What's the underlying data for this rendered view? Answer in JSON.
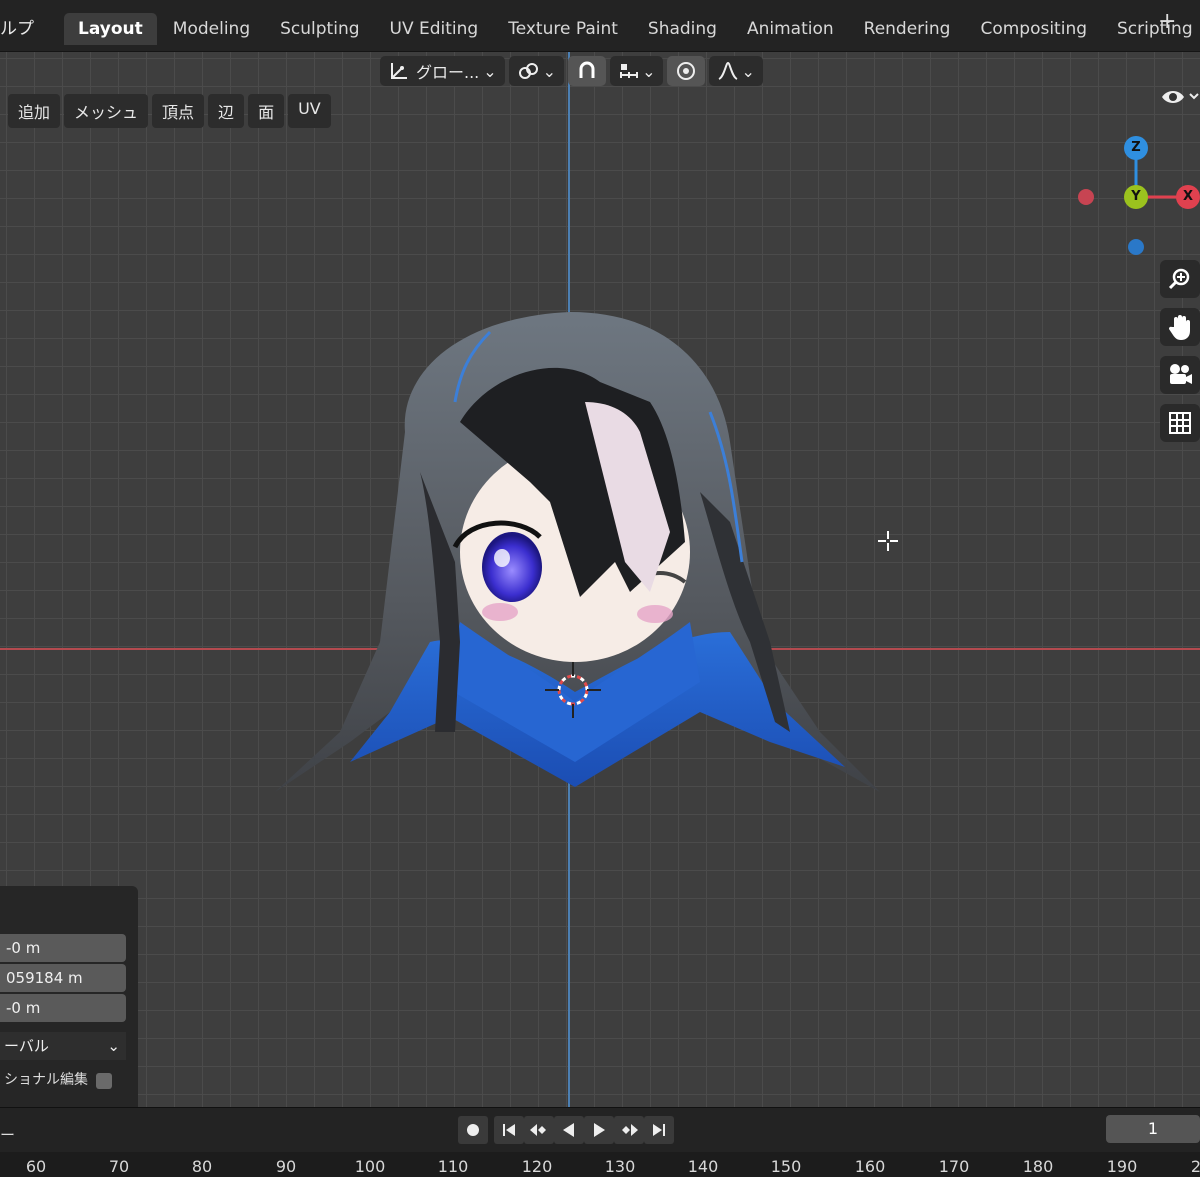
{
  "menu_fragment": "ルプ",
  "workspace_tabs": [
    {
      "label": "Layout",
      "active": true
    },
    {
      "label": "Modeling",
      "active": false
    },
    {
      "label": "Sculpting",
      "active": false
    },
    {
      "label": "UV Editing",
      "active": false
    },
    {
      "label": "Texture Paint",
      "active": false
    },
    {
      "label": "Shading",
      "active": false
    },
    {
      "label": "Animation",
      "active": false
    },
    {
      "label": "Rendering",
      "active": false
    },
    {
      "label": "Compositing",
      "active": false
    },
    {
      "label": "Scripting",
      "active": false
    }
  ],
  "add_workspace": "+",
  "header": {
    "orientation_label": "グロー...",
    "chevron": "⌄"
  },
  "edit_menu": [
    "追加",
    "メッシュ",
    "頂点",
    "辺",
    "面",
    "UV"
  ],
  "gizmo": {
    "z": "Z",
    "y": "Y",
    "x": "X"
  },
  "colors": {
    "x_axis": "#b44a4f",
    "y_axis": "#4c7fb2",
    "gizmo_x": "#e0414f",
    "gizmo_y": "#9bc21e",
    "gizmo_z": "#2f8fe0"
  },
  "last_operation": {
    "values": [
      "-0 m",
      "059184 m",
      "-0 m"
    ],
    "orientation": "ーバル",
    "proportional": "ショナル編集"
  },
  "timeline": {
    "label": "ー",
    "current_frame": "1",
    "ticks": [
      "60",
      "70",
      "80",
      "90",
      "100",
      "110",
      "120",
      "130",
      "140",
      "150",
      "160",
      "170",
      "180",
      "190",
      "2"
    ]
  }
}
